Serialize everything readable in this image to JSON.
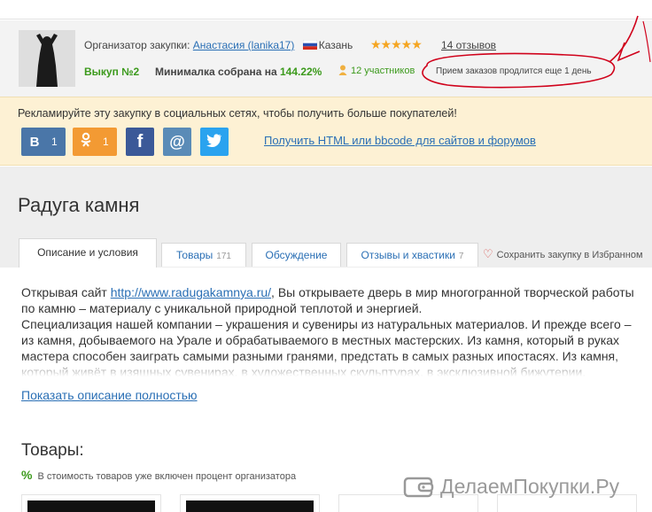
{
  "organizer": {
    "label": "Организатор закупки:",
    "name": "Анастасия (lanika17)",
    "city": "Казань",
    "reviews": "14 отзывов",
    "rating_stars": 5,
    "purchase": "Выкуп №2",
    "minimum_label": "Минималка собрана на",
    "minimum_value": "144.22%",
    "participants": "12 участников",
    "orders_note": "Прием заказов продлится еще 1 день"
  },
  "social": {
    "prompt": "Рекламируйте эту закупку в социальных сетях, чтобы получить больше покупателей!",
    "buttons": [
      {
        "icon": "vk-icon",
        "glyph": "В",
        "count": "1",
        "color": "#4a76a8"
      },
      {
        "icon": "ok-icon",
        "glyph": "ꝏ",
        "count": "1",
        "color": "#f39a33"
      },
      {
        "icon": "facebook-icon",
        "glyph": "f",
        "color": "#3b5998"
      },
      {
        "icon": "mail-icon",
        "glyph": "@",
        "color": "#5a8bb7"
      },
      {
        "icon": "twitter-icon",
        "glyph": "🐦",
        "color": "#2aa3ef"
      }
    ],
    "get_link": "Получить HTML или bbcode для сайтов и форумов"
  },
  "page": {
    "title": "Радуга камня"
  },
  "tabs": [
    {
      "label": "Описание и условия",
      "count": "",
      "active": true
    },
    {
      "label": "Товары",
      "count": "171",
      "active": false
    },
    {
      "label": "Обсуждение",
      "count": "",
      "active": false
    },
    {
      "label": "Отзывы и хвастики",
      "count": "7",
      "active": false
    }
  ],
  "favorite_label": "Сохранить закупку в Избранном",
  "description": {
    "intro": "Открывая сайт ",
    "link": "http://www.radugakamnya.ru/",
    "p1_rest": ", Вы открываете дверь в мир многогранной творческой работы по камню – материалу с уникальной природной теплотой и энергией.",
    "p2": "Специализация нашей компании – украшения и сувениры из натуральных материалов. И прежде всего – из камня, добываемого на Урале и обрабатываемого в местных мастерских. Из камня, который в руках мастера способен заиграть самыми разными гранями, предстать в самых разных ипостасях. Из камня, который живёт в изящных сувенирах, в художественных скульптурах, в эксклюзивной бижутерии.",
    "show_all": "Показать описание полностью"
  },
  "goods": {
    "heading": "Товары:",
    "percent_note": "В стоимость товаров уже включен процент организатора"
  },
  "watermark": "ДелаемПокупки.Ру",
  "colors": {
    "accent_link": "#2a6fb5",
    "green": "#3c9a1c",
    "annotation_red": "#d0021b"
  }
}
